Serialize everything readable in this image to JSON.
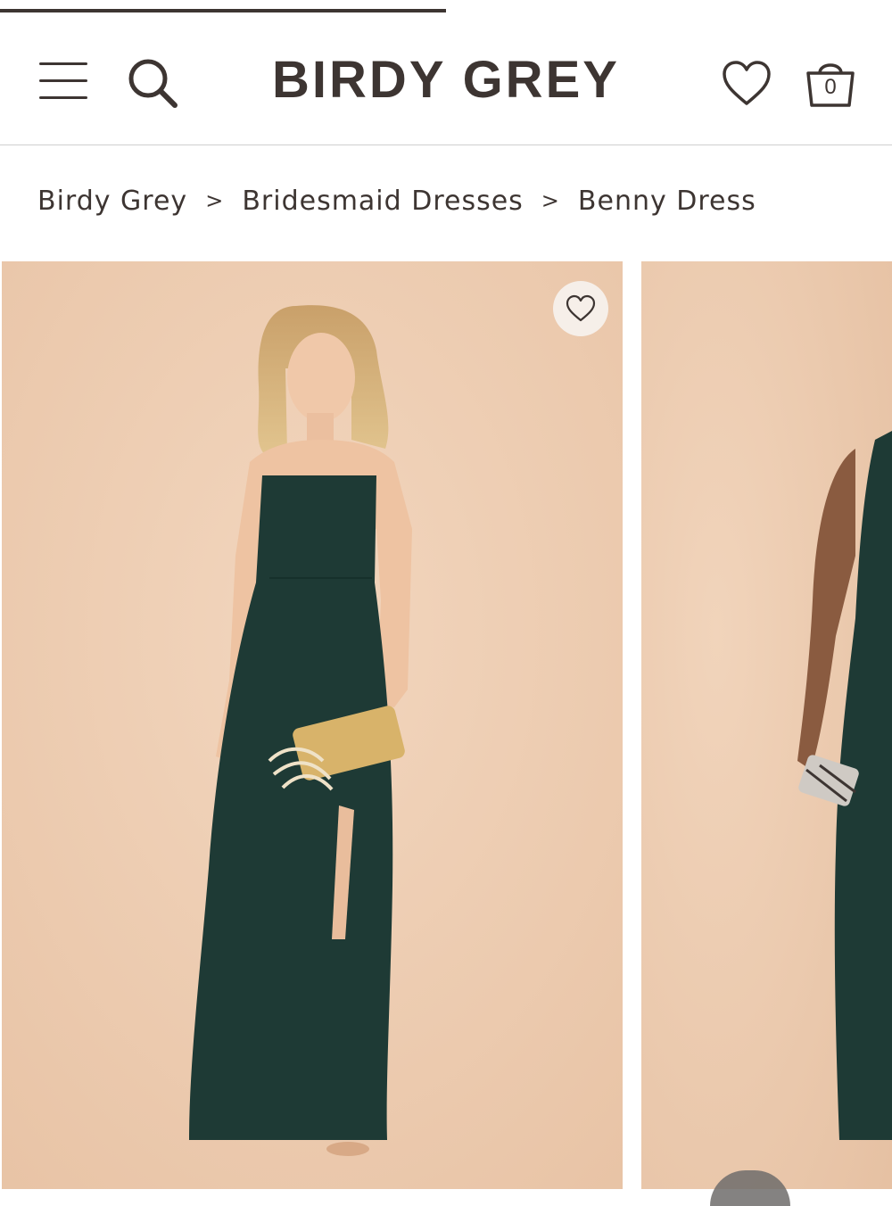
{
  "page_load_progress": 0.5,
  "header": {
    "brand": "BIRDY GREY",
    "bag_count": "0",
    "icons": [
      "menu-icon",
      "search-icon",
      "heart-icon",
      "shopping-bag-icon"
    ]
  },
  "breadcrumb": {
    "items": [
      "Birdy Grey",
      "Bridesmaid Dresses",
      "Benny Dress"
    ],
    "separator": ">"
  },
  "gallery": {
    "images": [
      {
        "alt": "Benny Dress"
      },
      {
        "alt": "Benny Dress"
      }
    ],
    "favorite_icon": "heart-icon"
  },
  "colors": {
    "brand_text": "#3d3532",
    "backdrop": "#efcfb4",
    "dress": "#1e3a35",
    "fav_button_bg": "#f6efe9"
  }
}
